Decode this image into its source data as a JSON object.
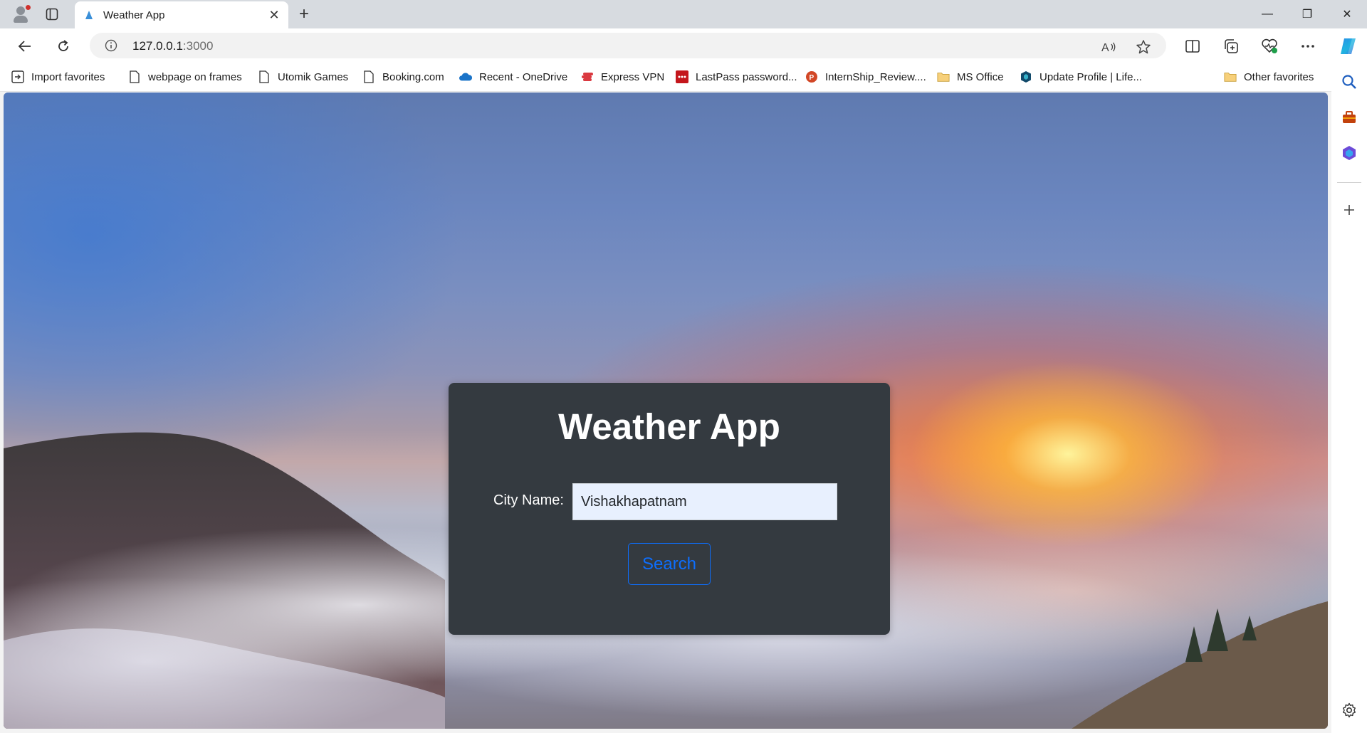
{
  "browser": {
    "tab": {
      "title": "Weather App",
      "close_glyph": "✕"
    },
    "new_tab_glyph": "+",
    "window_controls": {
      "minimize": "—",
      "restore": "❐",
      "close": "✕"
    },
    "address": {
      "host": "127.0.0.1",
      "port": ":3000"
    },
    "favorites": [
      {
        "label": "Import favorites",
        "icon": "import-icon"
      },
      {
        "label": "webpage on frames",
        "icon": "page-icon"
      },
      {
        "label": "Utomik Games",
        "icon": "page-icon"
      },
      {
        "label": "Booking.com",
        "icon": "page-icon"
      },
      {
        "label": "Recent - OneDrive",
        "icon": "onedrive-icon"
      },
      {
        "label": "Express VPN",
        "icon": "expressvpn-icon"
      },
      {
        "label": "LastPass password...",
        "icon": "lastpass-icon"
      },
      {
        "label": "InternShip_Review....",
        "icon": "powerpoint-icon"
      },
      {
        "label": "MS Office",
        "icon": "folder-icon"
      },
      {
        "label": "Update Profile | Life...",
        "icon": "shield-icon"
      }
    ],
    "other_favorites": "Other favorites"
  },
  "app": {
    "title": "Weather App",
    "city_label": "City Name:",
    "city_value": "Vishakhapatnam",
    "search_label": "Search"
  },
  "colors": {
    "card_bg": "#343a40",
    "button_accent": "#0d6efd",
    "input_bg": "#e8f0fe"
  }
}
